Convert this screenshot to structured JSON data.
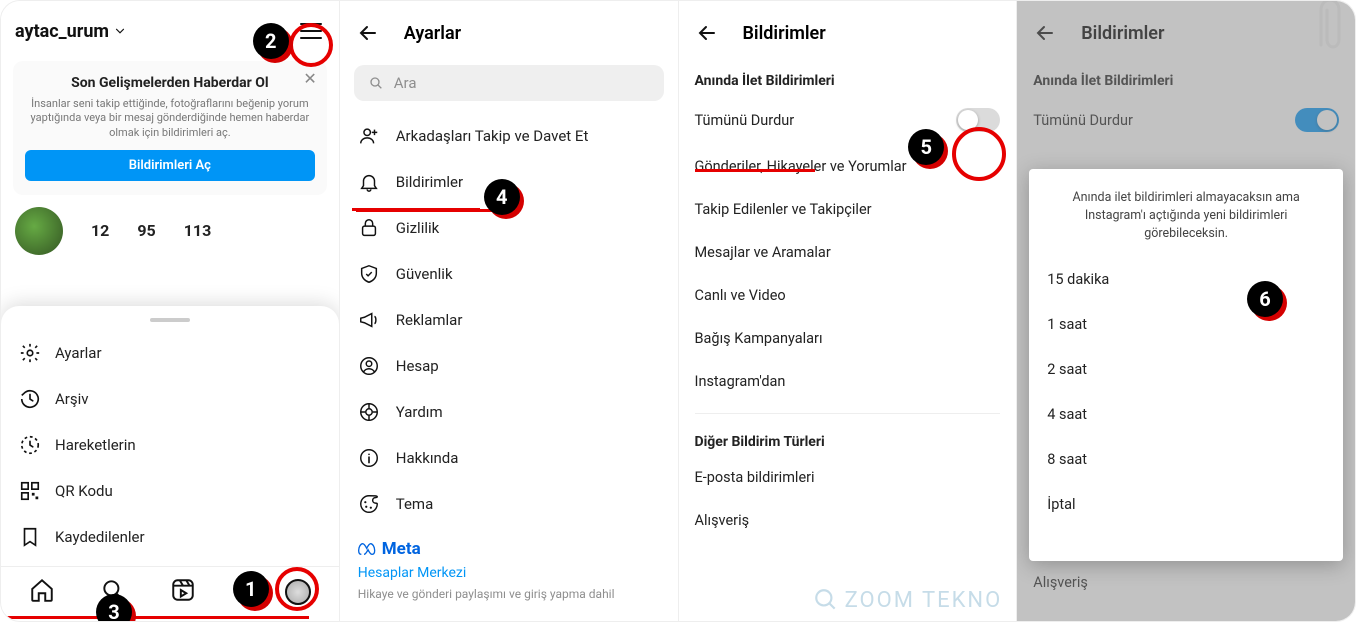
{
  "panel1": {
    "username": "aytac_urum",
    "card": {
      "title": "Son Gelişmelerden Haberdar Ol",
      "sub": "İnsanlar seni takip ettiğinde, fotoğraflarını beğenip yorum yaptığında veya bir mesaj gönderdiğinde hemen haberdar olmak için bildirimleri aç.",
      "button": "Bildirimleri Aç"
    },
    "stats": {
      "a": "12",
      "b": "95",
      "c": "113"
    },
    "sheet": {
      "ayarlar": "Ayarlar",
      "arsiv": "Arşiv",
      "hareketlerin": "Hareketlerin",
      "qrkodu": "QR Kodu",
      "kaydedilenler": "Kaydedilenler"
    }
  },
  "panel2": {
    "title": "Ayarlar",
    "search_placeholder": "Ara",
    "items": {
      "takip": "Arkadaşları Takip ve Davet Et",
      "bildirimler": "Bildirimler",
      "gizlilik": "Gizlilik",
      "guvenlik": "Güvenlik",
      "reklamlar": "Reklamlar",
      "hesap": "Hesap",
      "yardim": "Yardım",
      "hakkinda": "Hakkında",
      "tema": "Tema"
    },
    "meta": {
      "brand": "Meta",
      "link": "Hesaplar Merkezi",
      "sub": "Hikaye ve gönderi paylaşımı ve giriş yapma dahil"
    }
  },
  "panel3": {
    "title": "Bildirimler",
    "push_h": "Anında İlet Bildirimleri",
    "rows": {
      "tumunu": "Tümünü Durdur",
      "gonderiler": "Gönderiler, Hikayeler ve Yorumlar",
      "takip": "Takip Edilenler ve Takipçiler",
      "mesajlar": "Mesajlar ve Aramalar",
      "canli": "Canlı ve Video",
      "bagis": "Bağış Kampanyaları",
      "instagramdan": "Instagram'dan"
    },
    "other_h": "Diğer Bildirim Türleri",
    "other": {
      "eposta": "E-posta bildirimleri",
      "alisveris": "Alışveriş"
    },
    "watermark": "ZOOM TEKNO"
  },
  "panel4": {
    "title": "Bildirimler",
    "push_h": "Anında İlet Bildirimleri",
    "tumunu": "Tümünü Durdur",
    "alisveris": "Alışveriş",
    "sheet_msg": "Anında ilet bildirimleri almayacaksın ama Instagram'ı açtığında yeni bildirimleri görebileceksin.",
    "opts": {
      "o15": "15 dakika",
      "o1s": "1 saat",
      "o2s": "2 saat",
      "o4s": "4 saat",
      "o8s": "8 saat",
      "iptal": "İptal"
    }
  },
  "steps": {
    "s1": "1",
    "s2": "2",
    "s3": "3",
    "s4": "4",
    "s5": "5",
    "s6": "6"
  }
}
